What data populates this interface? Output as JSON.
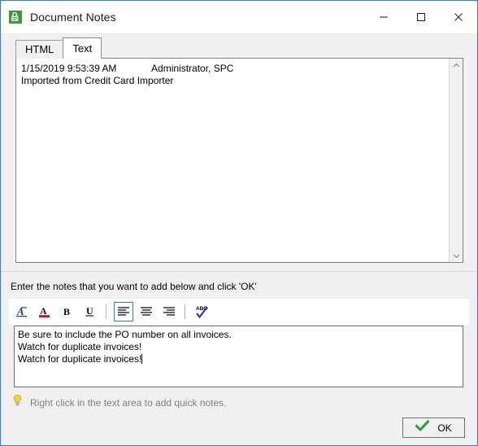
{
  "window": {
    "title": "Document Notes",
    "icon": "document-lock-icon",
    "border_color": "#2a7fd4",
    "controls": [
      {
        "name": "minimize",
        "glyph": "minimize-icon"
      },
      {
        "name": "maximize",
        "glyph": "maximize-icon"
      },
      {
        "name": "close",
        "glyph": "close-icon"
      }
    ]
  },
  "tabs": [
    {
      "label": "HTML",
      "active": false
    },
    {
      "label": "Text",
      "active": true
    }
  ],
  "notes_panel": {
    "entry_header": "1/15/2019 9:53:39 AM\t\tAdministrator, SPC",
    "entry_body": "Imported from Credit Card Importer",
    "scrollbar": {
      "up_icon": "chevron-up-icon",
      "down_icon": "chevron-down-icon"
    }
  },
  "prompt": {
    "label": "Enter the notes that you want to add below and click 'OK'"
  },
  "toolbar": {
    "items": [
      {
        "name": "font-button",
        "icon": "font-a-icon",
        "selected": false
      },
      {
        "name": "font-color-button",
        "icon": "font-color-a-icon",
        "selected": false
      },
      {
        "name": "bold-button",
        "icon": "bold-icon",
        "label": "B",
        "selected": false
      },
      {
        "name": "underline-button",
        "icon": "underline-icon",
        "label": "U",
        "selected": false
      },
      {
        "name": "align-left-button",
        "icon": "align-left-icon",
        "selected": true
      },
      {
        "name": "align-center-button",
        "icon": "align-center-icon",
        "selected": false
      },
      {
        "name": "align-right-button",
        "icon": "align-right-icon",
        "selected": false
      },
      {
        "name": "spellcheck-button",
        "icon": "abc-spellcheck-icon",
        "selected": false
      }
    ],
    "selected_color": "#2a7fd4"
  },
  "notes_input": {
    "lines": [
      "Be sure to include the PO number on all invoices.",
      "Watch for duplicate invoices!",
      "Watch for duplicate invoices!"
    ]
  },
  "hint": {
    "icon": "lightbulb-icon",
    "text": "Right click in the text area to add quick notes.",
    "color": "#808080"
  },
  "ok_button": {
    "label": "OK",
    "icon": "green-check-icon",
    "icon_color": "#3aa93a"
  }
}
